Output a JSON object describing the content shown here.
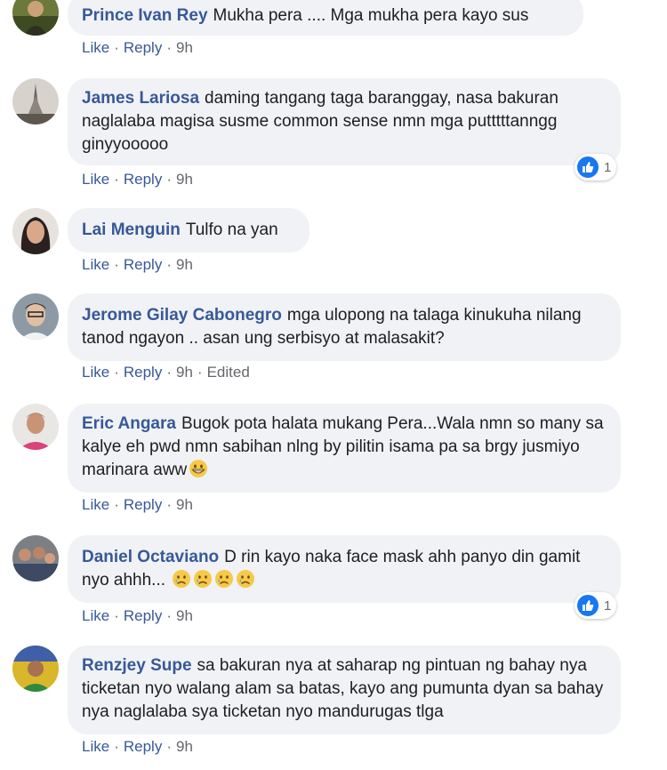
{
  "actions": {
    "like": "Like",
    "reply": "Reply",
    "time": "9h",
    "edited": "Edited"
  },
  "comments": [
    {
      "author": "Prince Ivan Rey",
      "text": "Mukha pera .... Mga mukha pera kayo sus"
    },
    {
      "author": "James Lariosa",
      "text": "daming tangang taga baranggay, nasa bakuran naglalaba magisa susme common sense nmn mga putttttanngg ginyyooooo",
      "reactions": "1"
    },
    {
      "author": "Lai Menguin",
      "text": "Tulfo na yan"
    },
    {
      "author": "Jerome Gilay Cabonegro",
      "text": "mga ulopong na talaga kinukuha nilang tanod ngayon .. asan ung serbisyo at malasakit?"
    },
    {
      "author": "Eric Angara",
      "text": "Bugok pota halata mukang Pera...Wala nmn so many sa kalye eh pwd nmn sabihan nlng by pilitin isama pa sa brgy jusmiyo marinara aww"
    },
    {
      "author": "Daniel Octaviano",
      "text": "D rin kayo naka face mask ahh panyo din gamit nyo ahhh...",
      "reactions": "1"
    },
    {
      "author": "Renzjey Supe",
      "text": "sa bakuran nya at saharap ng pintuan ng bahay nya ticketan nyo walang alam sa batas, kayo ang pumunta dyan sa bahay nya naglalaba sya ticketan nyo mandurugas tlga"
    }
  ],
  "icons": {
    "like": "thumbs-up-icon",
    "emoji_grin": "grinning-face-icon",
    "emoji_sad": "sad-face-icon"
  },
  "colors": {
    "author": "#385898",
    "bubble": "#f0f2f5",
    "like_blue": "#1877f2"
  }
}
